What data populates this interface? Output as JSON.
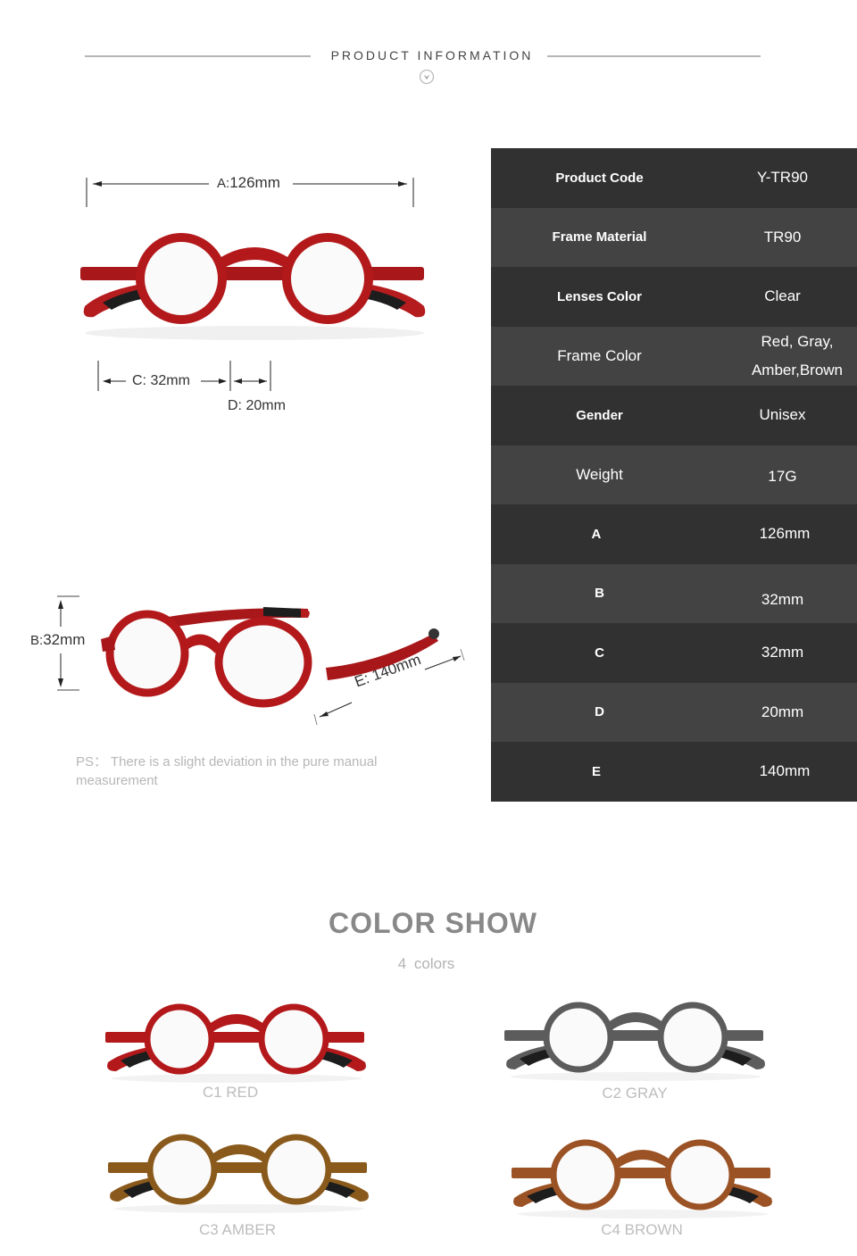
{
  "header": {
    "title": "PRODUCT INFORMATION",
    "icon": "chevron-down-circle-icon"
  },
  "dimensions": {
    "a_label": "A:",
    "a_value": "126mm",
    "c_label": "C: 32mm",
    "d_label": "D: 20mm",
    "b_label": "B:",
    "b_value": "32mm",
    "e_label": "E: 140mm"
  },
  "note": "PS： There is a slight deviation in the pure manual measurement",
  "spec_table": {
    "rows": [
      {
        "label": "Product Code",
        "value": "Y-TR90"
      },
      {
        "label": "Frame Material",
        "value": "TR90"
      },
      {
        "label": "Lenses Color",
        "value": "Clear"
      },
      {
        "label": "Frame Color",
        "value": "Red, Gray, Amber,Brown"
      },
      {
        "label": "Gender",
        "value": "Unisex"
      },
      {
        "label": "Weight",
        "value": "17G"
      },
      {
        "label": "A",
        "value": "126mm"
      },
      {
        "label": "B",
        "value": "32mm"
      },
      {
        "label": "C",
        "value": "32mm"
      },
      {
        "label": "D",
        "value": "20mm"
      },
      {
        "label": "E",
        "value": "140mm"
      }
    ]
  },
  "color_show": {
    "title": "COLOR SHOW",
    "subtitle": "4  colors",
    "variants": [
      {
        "label": "C1 RED",
        "color": "#b3191b"
      },
      {
        "label": "C2 GRAY",
        "color": "#5c5c5c"
      },
      {
        "label": "C3 AMBER",
        "color": "#8a5a1c"
      },
      {
        "label": "C4 BROWN",
        "color": "#9b5224"
      }
    ]
  }
}
